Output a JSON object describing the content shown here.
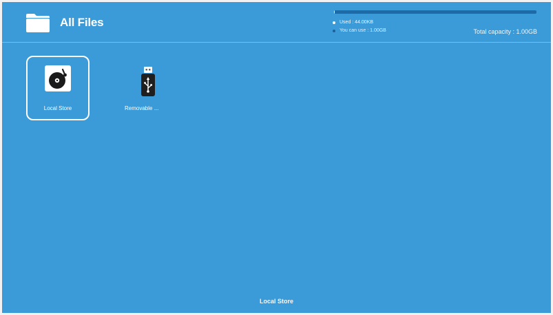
{
  "header": {
    "title": "All Files",
    "icon": "folder-icon"
  },
  "capacity": {
    "used_label": "Used : 44.00KB",
    "free_label": "You can use : 1.00GB",
    "total_label": "Total capacity : 1.00GB",
    "used_fraction": 4e-05,
    "colors": {
      "used": "#ffffff",
      "free": "#1e5f9a"
    }
  },
  "storage": [
    {
      "label": "Local Store",
      "icon": "vinyl-record-icon",
      "selected": true
    },
    {
      "label": "Removable ...",
      "icon": "usb-drive-icon",
      "selected": false
    }
  ],
  "footer": {
    "label": "Local Store"
  },
  "colors": {
    "background": "#3a9bd8"
  }
}
